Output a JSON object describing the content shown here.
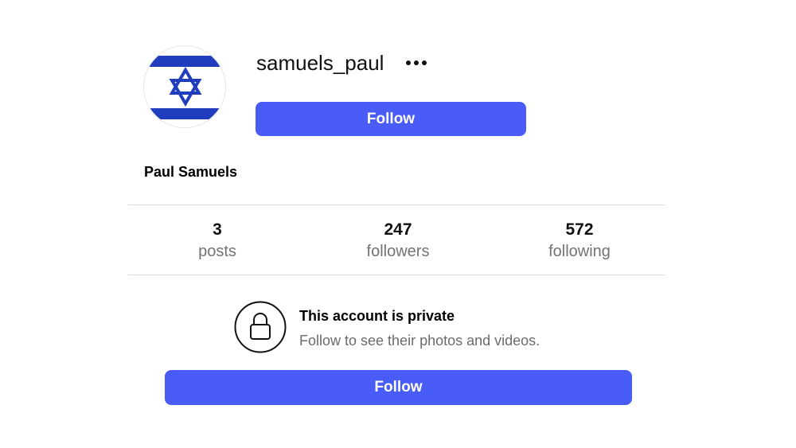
{
  "profile": {
    "username": "samuels_paul",
    "full_name": "Paul Samuels",
    "avatar_icon": "israel-flag-icon",
    "more_icon": "more-options-icon"
  },
  "actions": {
    "follow_label": "Follow",
    "follow_bottom_label": "Follow",
    "accent_color": "#4a5cf6"
  },
  "stats": {
    "posts": {
      "value": "3",
      "label": "posts"
    },
    "followers": {
      "value": "247",
      "label": "followers"
    },
    "following": {
      "value": "572",
      "label": "following"
    }
  },
  "private_notice": {
    "icon": "lock-icon",
    "title": "This account is private",
    "subtitle": "Follow to see their photos and videos."
  }
}
